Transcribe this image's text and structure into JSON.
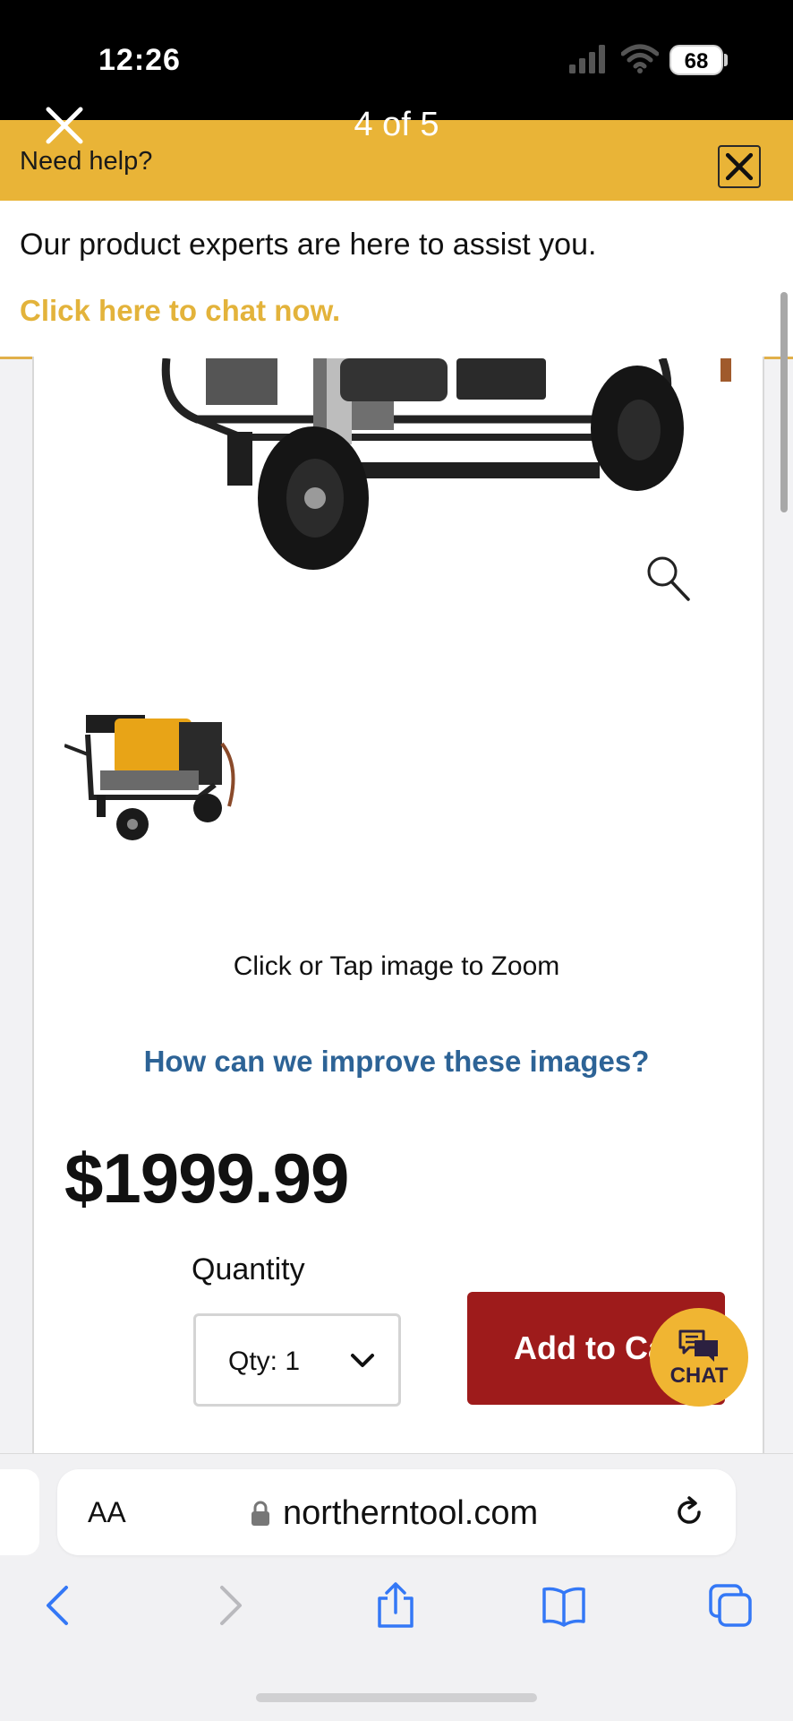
{
  "status_bar": {
    "time": "12:26",
    "battery": "68"
  },
  "viewer": {
    "counter": "4 of 5"
  },
  "help": {
    "title": "Need help?",
    "message": "Our product experts are here to assist you.",
    "chat_link": "Click here to chat now."
  },
  "product": {
    "zoom_hint": "Click or Tap image to Zoom",
    "improve_link": "How can we improve these images?",
    "price": "$1999.99",
    "quantity_label": "Quantity",
    "quantity_value": "Qty: 1",
    "add_to_cart": "Add to Cart"
  },
  "chat_fab": {
    "label": "CHAT"
  },
  "browser": {
    "aa": "AA",
    "url": "northerntool.com"
  },
  "colors": {
    "help_banner": "#e9b437",
    "link_gold": "#e3b33b",
    "link_blue": "#2d6396",
    "cart_red": "#9e1b1b",
    "ios_blue": "#3478f6"
  }
}
